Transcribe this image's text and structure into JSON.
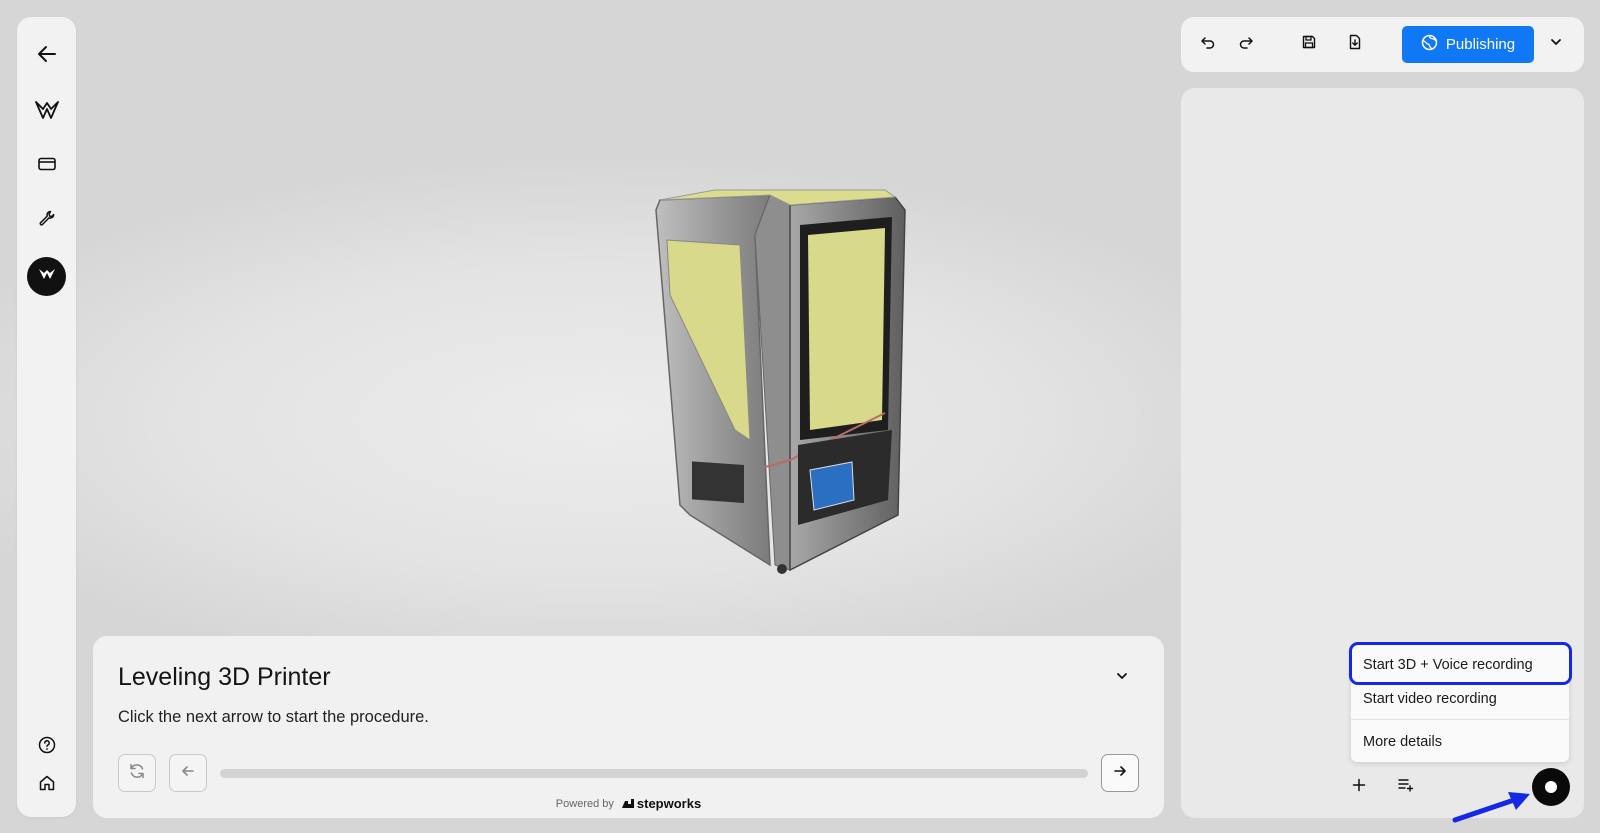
{
  "sidebar": {
    "items": [
      {
        "name": "back",
        "icon": "arrow-left-icon"
      },
      {
        "name": "logo",
        "icon": "stepworks-logo-icon"
      },
      {
        "name": "cards",
        "icon": "card-icon"
      },
      {
        "name": "tools",
        "icon": "wrench-icon"
      },
      {
        "name": "brand",
        "icon": "brand-circle-icon"
      }
    ],
    "bottom": [
      {
        "name": "help",
        "icon": "help-circle-icon"
      },
      {
        "name": "home",
        "icon": "home-icon"
      }
    ]
  },
  "toolbar": {
    "undo_icon": "undo-icon",
    "redo_icon": "redo-icon",
    "save_icon": "save-icon",
    "download_icon": "download-icon",
    "publish_label": "Publishing",
    "publish_color": "#1178f5"
  },
  "procedure": {
    "title": "Leveling 3D Printer",
    "description": "Click the next arrow to start the procedure.",
    "powered_by": "Powered by",
    "brand": "stepworks"
  },
  "recording_menu": {
    "items": [
      {
        "label": "Start 3D + Voice recording"
      },
      {
        "label": "Start video recording"
      },
      {
        "label": "More details"
      }
    ],
    "highlight_color": "#1428e6"
  },
  "colors": {
    "accent": "#1178f5",
    "annotation_blue": "#1428e6"
  }
}
